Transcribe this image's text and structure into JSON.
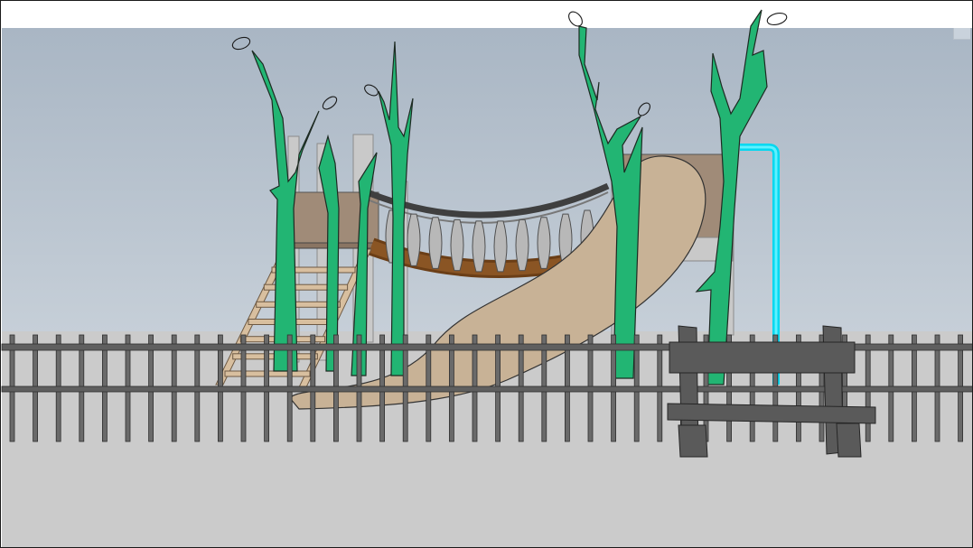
{
  "scene": {
    "type": "3d-model-viewport",
    "description_elements": [
      "playground",
      "rope-bridge",
      "wavy-slide",
      "ladder",
      "trees",
      "fence",
      "bench",
      "blue-railing"
    ]
  },
  "colors": {
    "sky_top": "#a9b6c4",
    "sky_bottom": "#c3ccd6",
    "ground": "#cbcbcb",
    "fence": "#6a6a6a",
    "fence_dark": "#3a3a3a",
    "tree": "#22b573",
    "slide": "#c8b296",
    "platform": "#a08b78",
    "bridge_plank": "#7b4a1c",
    "rope": "#4a4a4a",
    "baluster": "#b8b8b8",
    "ladder": "#d8bf9f",
    "bench": "#5a5a5a",
    "railing": "#00e5ff",
    "post": "#c8c8c8"
  },
  "icons": [
    "leaf-outline-icon"
  ]
}
